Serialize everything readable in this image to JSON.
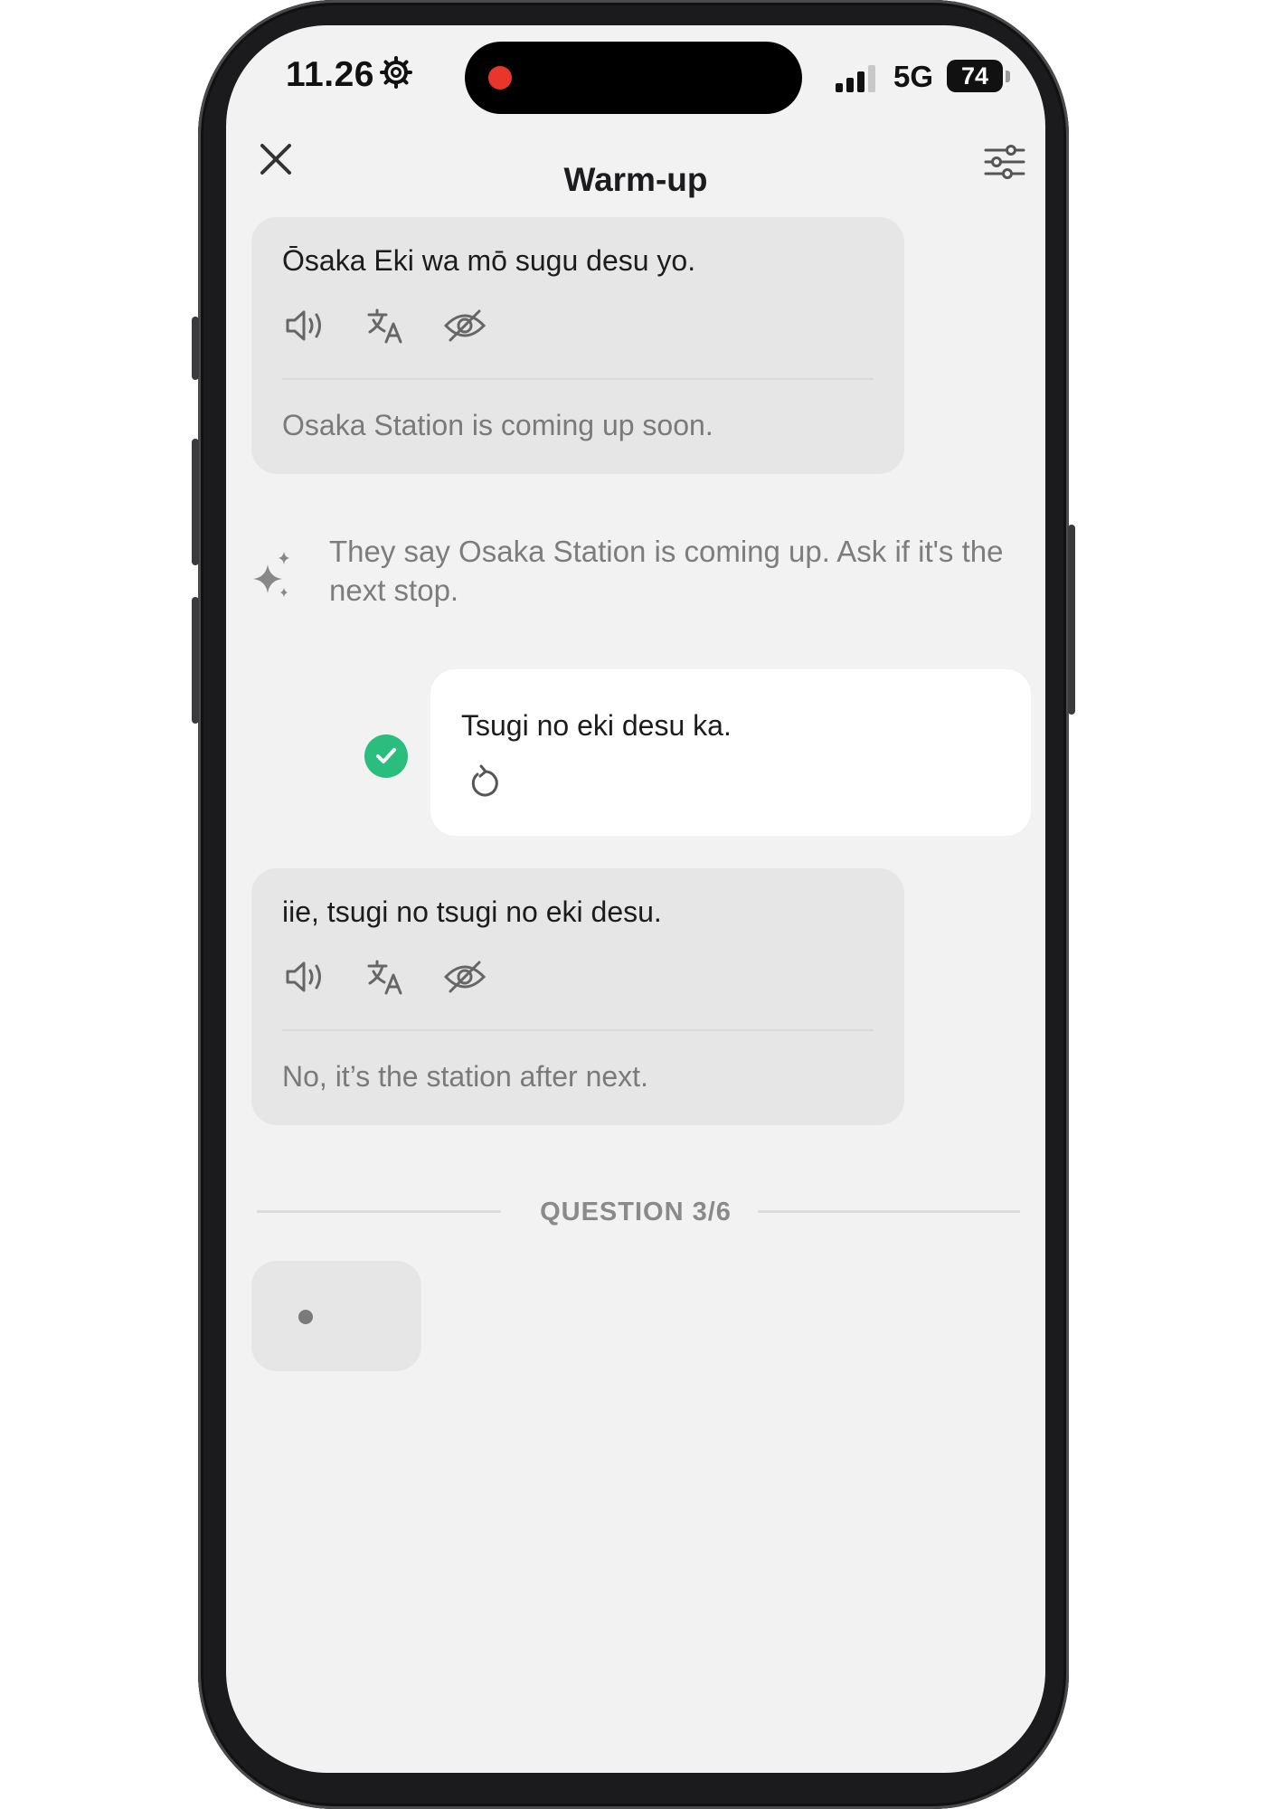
{
  "status_bar": {
    "time": "11.26",
    "network": "5G",
    "battery": "74"
  },
  "nav": {
    "title": "Warm-up"
  },
  "messages": [
    {
      "text": "Ōsaka Eki wa mō sugu desu yo.",
      "translation": "Osaka Station is coming up soon."
    },
    {
      "text": "iie, tsugi no tsugi no eki desu.",
      "translation": "No, it’s the station after next."
    }
  ],
  "hint": {
    "text": "They say Osaka Station is coming up. Ask if it's the next stop."
  },
  "user_answer": {
    "text": "Tsugi no eki desu ka."
  },
  "progress": {
    "label": "QUESTION 3/6"
  },
  "colors": {
    "accent_green": "#2bbd7e",
    "recording_red": "#e8362c",
    "bubble_grey": "#e6e6e6",
    "screen_bg": "#f2f2f2"
  },
  "icons": [
    "gear-icon",
    "signal-icon",
    "close-icon",
    "settings-sliders-icon",
    "speaker-icon",
    "translate-icon",
    "eye-off-icon",
    "sparkle-icon",
    "checkmark-icon",
    "retry-icon"
  ]
}
